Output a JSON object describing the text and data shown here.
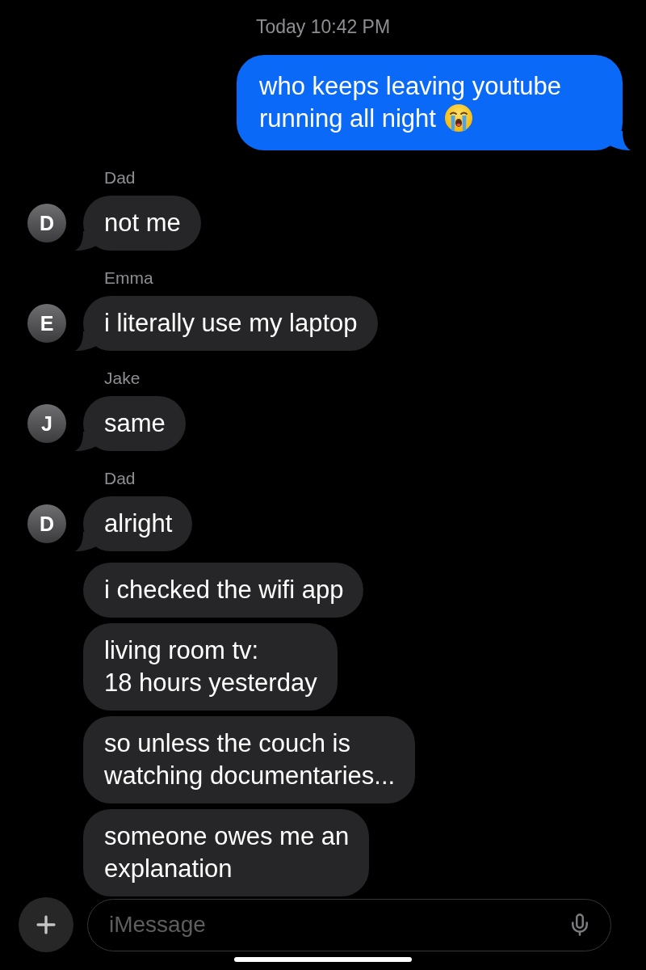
{
  "timestamp": "Today 10:42 PM",
  "messages": [
    {
      "kind": "outgoing",
      "text": "who keeps leaving youtube\nrunning all night",
      "emoji": true,
      "tail": true
    },
    {
      "kind": "incoming",
      "sender": "Dad",
      "avatar": "D",
      "text": "not me",
      "tail": true
    },
    {
      "kind": "incoming",
      "sender": "Emma",
      "avatar": "E",
      "text": "i literally use my laptop",
      "tail": true
    },
    {
      "kind": "incoming",
      "sender": "Jake",
      "avatar": "J",
      "text": "same",
      "tail": true
    },
    {
      "kind": "incoming",
      "sender": "Dad",
      "avatar": "D",
      "text": "alright",
      "tail": true
    },
    {
      "kind": "incoming",
      "text": "i checked the wifi app",
      "tail": false
    },
    {
      "kind": "incoming",
      "text": "living room tv:\n18 hours yesterday",
      "tail": false
    },
    {
      "kind": "incoming",
      "text": "so unless the couch is\nwatching documentaries...",
      "tail": false
    },
    {
      "kind": "incoming",
      "text": "someone owes me an\nexplanation",
      "tail": false
    }
  ],
  "composer": {
    "placeholder": "iMessage"
  }
}
